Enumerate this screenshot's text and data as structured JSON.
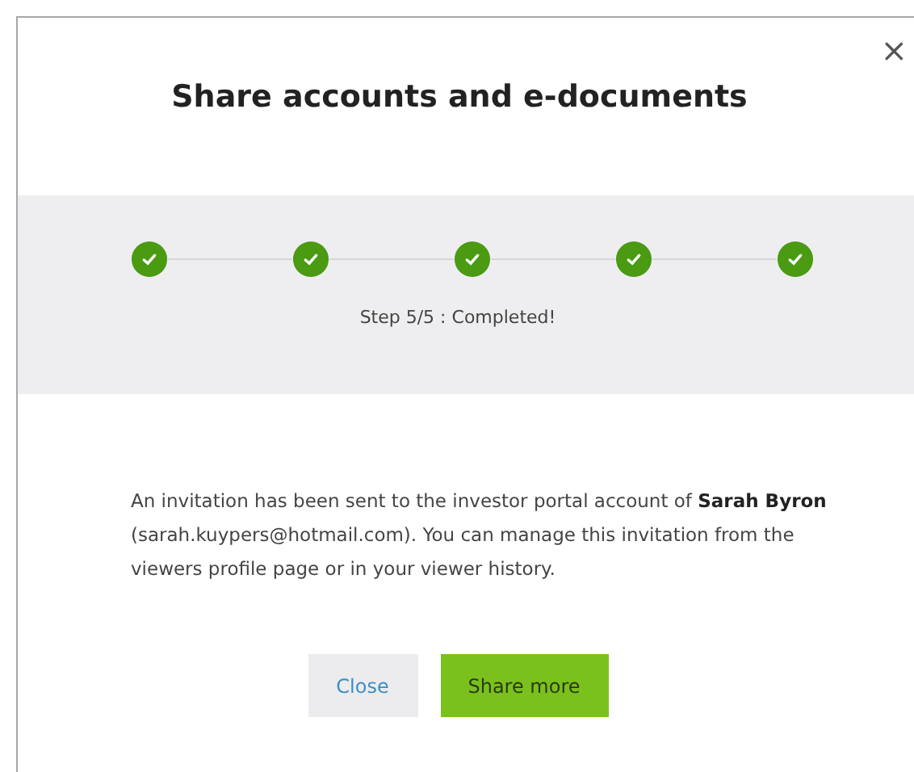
{
  "dialog": {
    "title": "Share accounts and e-documents",
    "close_icon": "×"
  },
  "steps": [
    {
      "completed": true
    },
    {
      "completed": true
    },
    {
      "completed": true
    },
    {
      "completed": true
    },
    {
      "completed": true
    }
  ],
  "step_status": "Step 5/5 : Completed!",
  "message": "An invitation has been sent to the investor portal account of **Sarah Byron** (sarah.kuypers@hotmail.com). You can manage this invitation from the viewers profile page or in your viewer history.",
  "buttons": [
    {
      "label": "Close",
      "kind": "secondary"
    },
    {
      "label": "Share more",
      "kind": "primary"
    }
  ]
}
